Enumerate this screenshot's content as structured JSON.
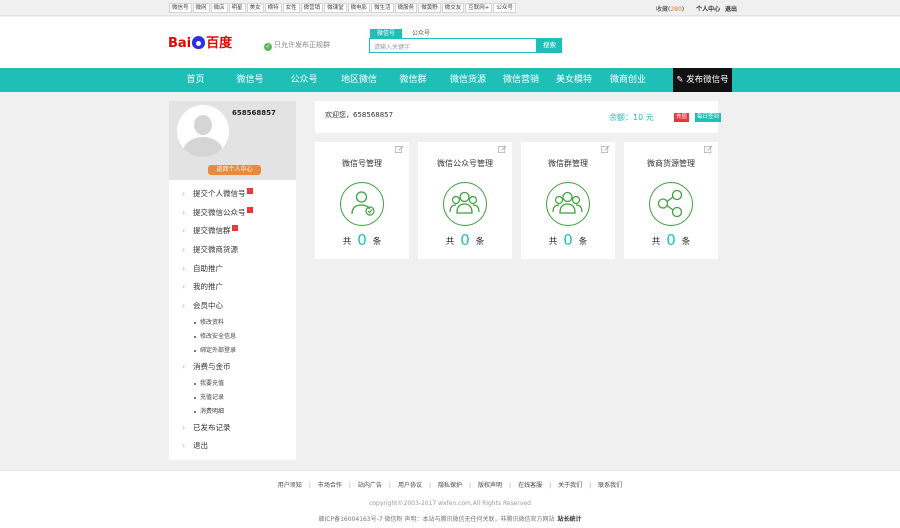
{
  "topbar": {
    "links": [
      "微信号",
      "微网",
      "微店",
      "明星",
      "美女",
      "横特",
      "女性",
      "微营销",
      "微课堂",
      "微电影",
      "微生活",
      "微服务",
      "微黄野",
      "微交友",
      "互联网+",
      "公众号"
    ],
    "collect_label": "收藏(",
    "collect_count": "280",
    "collect_close": ")",
    "user_center": "个人中心",
    "logout": "退出"
  },
  "header": {
    "logo_left": "Bai",
    "logo_right": "百度",
    "only_text": "只允许发布正规群",
    "search_tabs": [
      "微信号",
      "公众号"
    ],
    "search_placeholder": "请输入关键字",
    "search_button": "搜索"
  },
  "nav": {
    "items": [
      "首页",
      "微信号",
      "公众号",
      "地区微信",
      "微信群",
      "微信货源",
      "微信营销",
      "美女模特",
      "微商创业"
    ],
    "publish": "发布微信号"
  },
  "sidebar": {
    "user_id": "658568857",
    "back_button": "返回个人中心",
    "menu": [
      {
        "label": "提交个人微信号",
        "new": true
      },
      {
        "label": "提交微信公众号",
        "new": true
      },
      {
        "label": "提交微信群",
        "new": true
      },
      {
        "label": "提交微商货源"
      },
      {
        "label": "自助推广"
      },
      {
        "label": "我的推广"
      },
      {
        "label": "会员中心",
        "sub": [
          "修改资料",
          "修改安全信息",
          "绑定外部登录"
        ]
      },
      {
        "label": "消费与金币",
        "sub": [
          "我要充值",
          "充值记录",
          "消费明细"
        ]
      },
      {
        "label": "已发布记录"
      },
      {
        "label": "退出"
      }
    ]
  },
  "welcome": {
    "text": "欢迎您，658568857",
    "balance_label": "余额：",
    "balance_value": "10",
    "balance_unit": "元",
    "charge_button": "充值",
    "sign_button": "每日签到"
  },
  "cards": [
    {
      "title": "微信号管理",
      "prefix": "共",
      "count": "0",
      "suffix": "条",
      "icon": "single-user-check-icon"
    },
    {
      "title": "微信公众号管理",
      "prefix": "共",
      "count": "0",
      "suffix": "条",
      "icon": "user-group-icon"
    },
    {
      "title": "微信群管理",
      "prefix": "共",
      "count": "0",
      "suffix": "条",
      "icon": "user-group-icon"
    },
    {
      "title": "微商货源管理",
      "prefix": "共",
      "count": "0",
      "suffix": "条",
      "icon": "share-nodes-icon"
    }
  ],
  "footer": {
    "links": [
      "用户须知",
      "市场合作",
      "站内广告",
      "用户协议",
      "隐私保护",
      "版权声明",
      "在线客服",
      "关于我们",
      "联系我们"
    ],
    "copyright": "copyright©2003-2017 wxfen.com,All Rights Reserved",
    "beian": "赣ICP备16004163号-7 微信粉     声明：本站与腾讯微信无任何关联，非腾讯微信官方网站",
    "stats": "站长统计"
  },
  "colors": {
    "accent": "#1fbfb8",
    "icon_green": "#3ca03c",
    "orange": "#e98b3b",
    "red": "#e4393c"
  }
}
